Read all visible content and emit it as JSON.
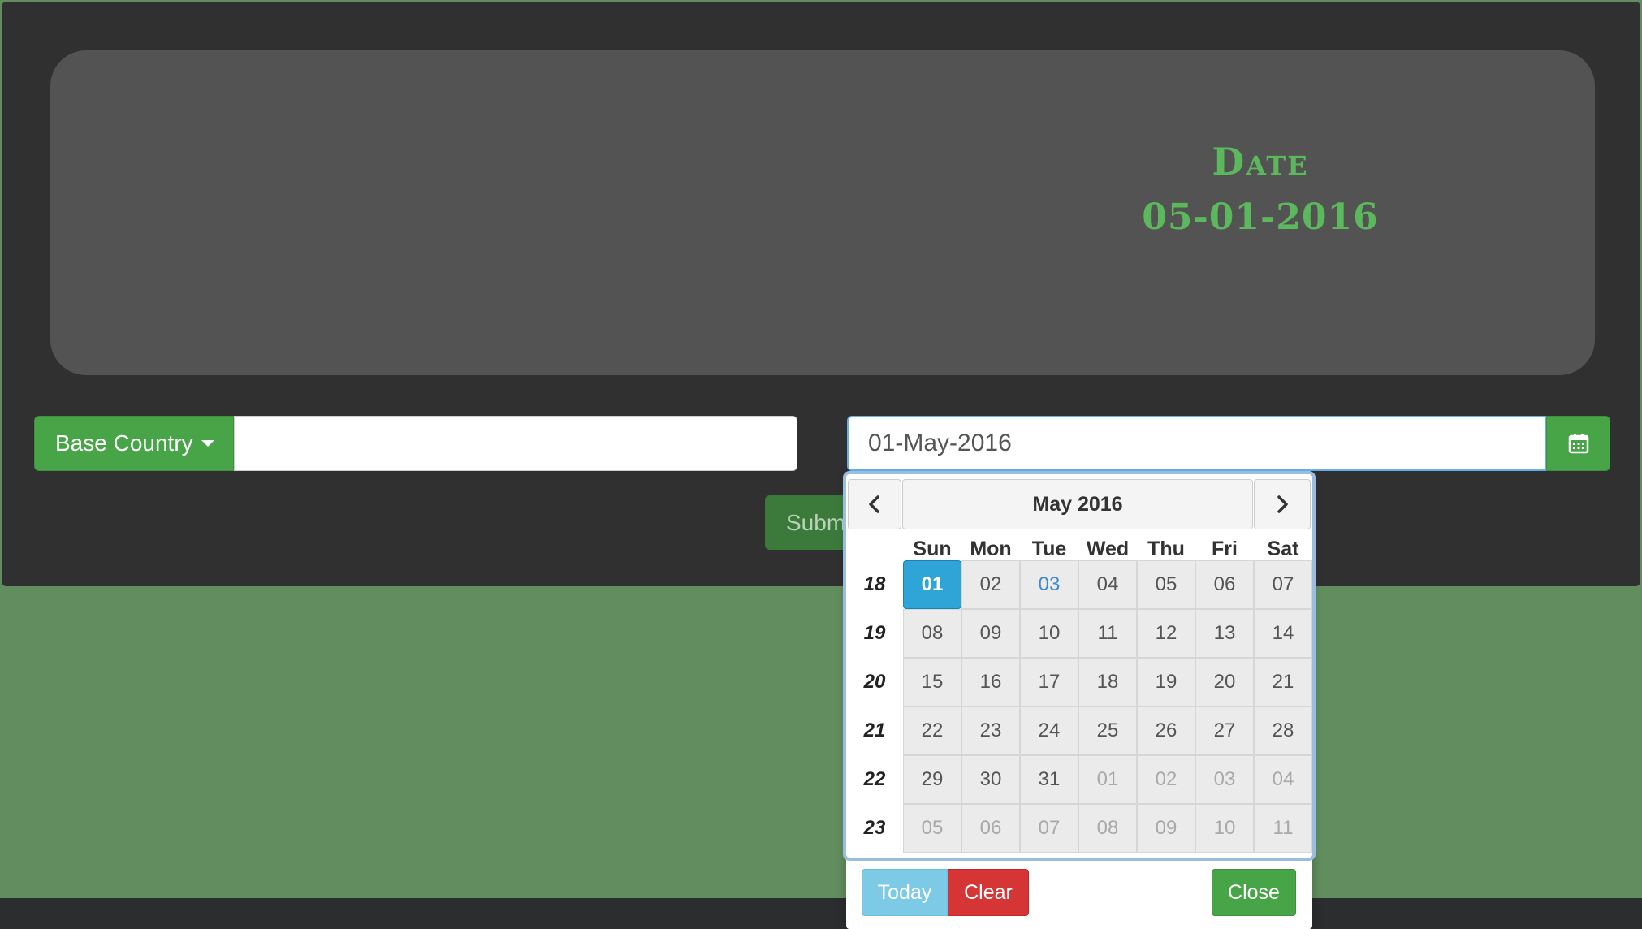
{
  "hero": {
    "label": "Date",
    "date": "05-01-2016"
  },
  "form": {
    "country_button": "Base Country",
    "country_value": "",
    "date_value": "01-May-2016",
    "submit_label": "Subm"
  },
  "icons": {
    "calendar": "calendar-icon",
    "prev": "chevron-left-icon",
    "next": "chevron-right-icon",
    "caret": "caret-down-icon"
  },
  "colors": {
    "accent_green": "#47a447",
    "hero_text": "#5cb85c",
    "selected_day": "#2fa4d6",
    "background": "#628e5f"
  },
  "datepicker": {
    "title": "May 2016",
    "weekdays": [
      "Sun",
      "Mon",
      "Tue",
      "Wed",
      "Thu",
      "Fri",
      "Sat"
    ],
    "weeks": [
      {
        "num": "18",
        "days": [
          {
            "d": "01",
            "state": "active"
          },
          {
            "d": "02",
            "state": ""
          },
          {
            "d": "03",
            "state": "today"
          },
          {
            "d": "04",
            "state": ""
          },
          {
            "d": "05",
            "state": ""
          },
          {
            "d": "06",
            "state": ""
          },
          {
            "d": "07",
            "state": ""
          }
        ]
      },
      {
        "num": "19",
        "days": [
          {
            "d": "08",
            "state": ""
          },
          {
            "d": "09",
            "state": ""
          },
          {
            "d": "10",
            "state": ""
          },
          {
            "d": "11",
            "state": ""
          },
          {
            "d": "12",
            "state": ""
          },
          {
            "d": "13",
            "state": ""
          },
          {
            "d": "14",
            "state": ""
          }
        ]
      },
      {
        "num": "20",
        "days": [
          {
            "d": "15",
            "state": ""
          },
          {
            "d": "16",
            "state": ""
          },
          {
            "d": "17",
            "state": ""
          },
          {
            "d": "18",
            "state": ""
          },
          {
            "d": "19",
            "state": ""
          },
          {
            "d": "20",
            "state": ""
          },
          {
            "d": "21",
            "state": ""
          }
        ]
      },
      {
        "num": "21",
        "days": [
          {
            "d": "22",
            "state": ""
          },
          {
            "d": "23",
            "state": ""
          },
          {
            "d": "24",
            "state": ""
          },
          {
            "d": "25",
            "state": ""
          },
          {
            "d": "26",
            "state": ""
          },
          {
            "d": "27",
            "state": ""
          },
          {
            "d": "28",
            "state": ""
          }
        ]
      },
      {
        "num": "22",
        "days": [
          {
            "d": "29",
            "state": ""
          },
          {
            "d": "30",
            "state": ""
          },
          {
            "d": "31",
            "state": ""
          },
          {
            "d": "01",
            "state": "muted"
          },
          {
            "d": "02",
            "state": "muted"
          },
          {
            "d": "03",
            "state": "muted"
          },
          {
            "d": "04",
            "state": "muted"
          }
        ]
      },
      {
        "num": "23",
        "days": [
          {
            "d": "05",
            "state": "muted"
          },
          {
            "d": "06",
            "state": "muted"
          },
          {
            "d": "07",
            "state": "muted"
          },
          {
            "d": "08",
            "state": "muted"
          },
          {
            "d": "09",
            "state": "muted"
          },
          {
            "d": "10",
            "state": "muted"
          },
          {
            "d": "11",
            "state": "muted"
          }
        ]
      }
    ],
    "today_label": "Today",
    "clear_label": "Clear",
    "close_label": "Close"
  }
}
